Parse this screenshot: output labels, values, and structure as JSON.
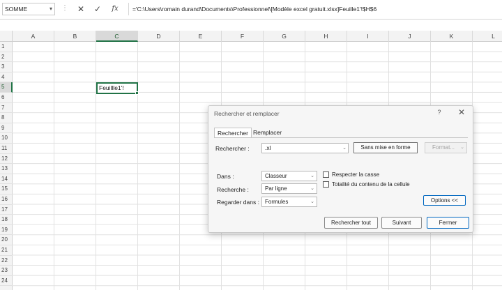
{
  "formula_bar": {
    "name_box": "SOMME",
    "name_box_arrow": "▾",
    "separator": "⋮",
    "cancel_glyph": "✕",
    "enter_glyph": "✓",
    "fx_label": "fx",
    "content": "='C:\\Users\\romain durand\\Documents\\Professionnel\\[Modèle excel gratuit.xlsx]Feuille1'!$H$6"
  },
  "sheet": {
    "columns": [
      "A",
      "B",
      "C",
      "D",
      "E",
      "F",
      "G",
      "H",
      "I",
      "J",
      "K",
      "L"
    ],
    "rows": [
      "1",
      "2",
      "3",
      "4",
      "5",
      "6",
      "7",
      "8",
      "9",
      "10",
      "11",
      "12",
      "13",
      "14",
      "15",
      "16",
      "17",
      "18",
      "19",
      "20",
      "21",
      "22",
      "23",
      "24"
    ],
    "active_column": "C",
    "active_row": "5",
    "active_cell_text": "Feuillle1'!",
    "accent_color": "#217346"
  },
  "dialog": {
    "title": "Rechercher et remplacer",
    "help_label": "?",
    "close_glyph": "✕",
    "tabs": [
      {
        "label": "Rechercher",
        "active": true
      },
      {
        "label": "Remplacer",
        "active": false
      }
    ],
    "find_label": "Rechercher :",
    "find_value": ".xl",
    "no_format_label": "Sans mise en forme",
    "format_label": "Format...",
    "within_label": "Dans :",
    "within_value": "Classeur",
    "search_label": "Recherche :",
    "search_value": "Par ligne",
    "lookin_label": "Regarder dans :",
    "lookin_value": "Formules",
    "match_case_label": "Respecter la casse",
    "match_case_checked": false,
    "entire_cell_label": "Totalité du contenu de la cellule",
    "entire_cell_checked": false,
    "options_label": "Options <<",
    "find_all_label": "Rechercher tout",
    "find_next_label": "Suivant",
    "close_label": "Fermer",
    "dropdown_glyph": "⌄",
    "focus_color": "#0067c0"
  }
}
